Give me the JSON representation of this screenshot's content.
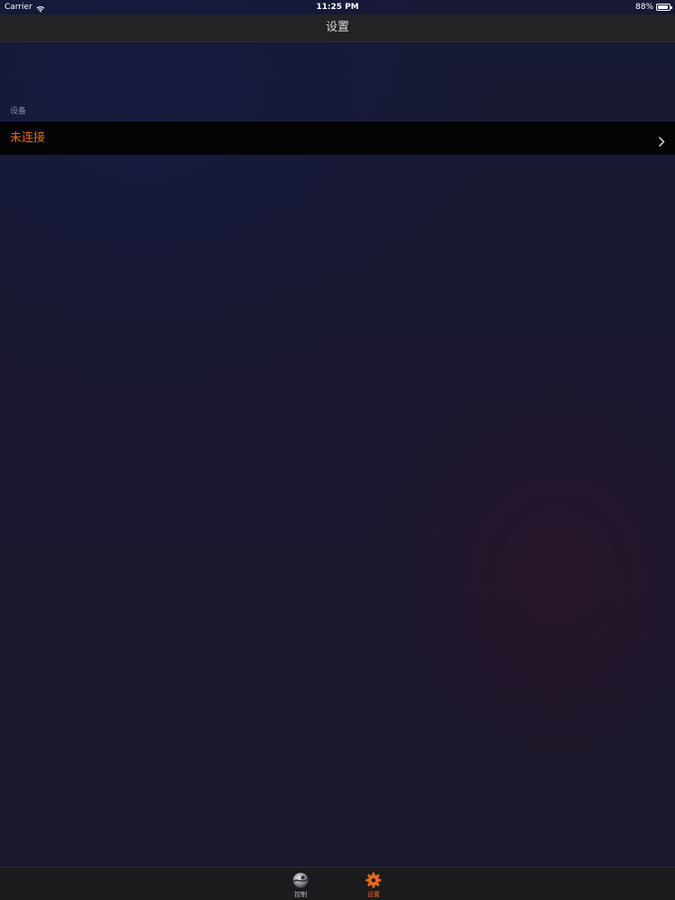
{
  "status_bar": {
    "carrier": "Carrier",
    "time": "11:25 PM",
    "battery": "88%",
    "battery_level": 0.88,
    "icons": [
      "wifi-icon",
      "battery-icon"
    ]
  },
  "nav": {
    "title": "设置"
  },
  "section": {
    "header": "设备",
    "row_label": "未连接",
    "row_icon": "chevron-right-icon"
  },
  "tabbar": {
    "tabs": [
      {
        "label": "控制",
        "icon": "control-ball-icon",
        "selected": false
      },
      {
        "label": "设置",
        "icon": "gear-icon",
        "selected": true
      }
    ]
  },
  "colors": {
    "accent": "#e8691e",
    "background": "#19182f",
    "row_background": "#050507"
  }
}
